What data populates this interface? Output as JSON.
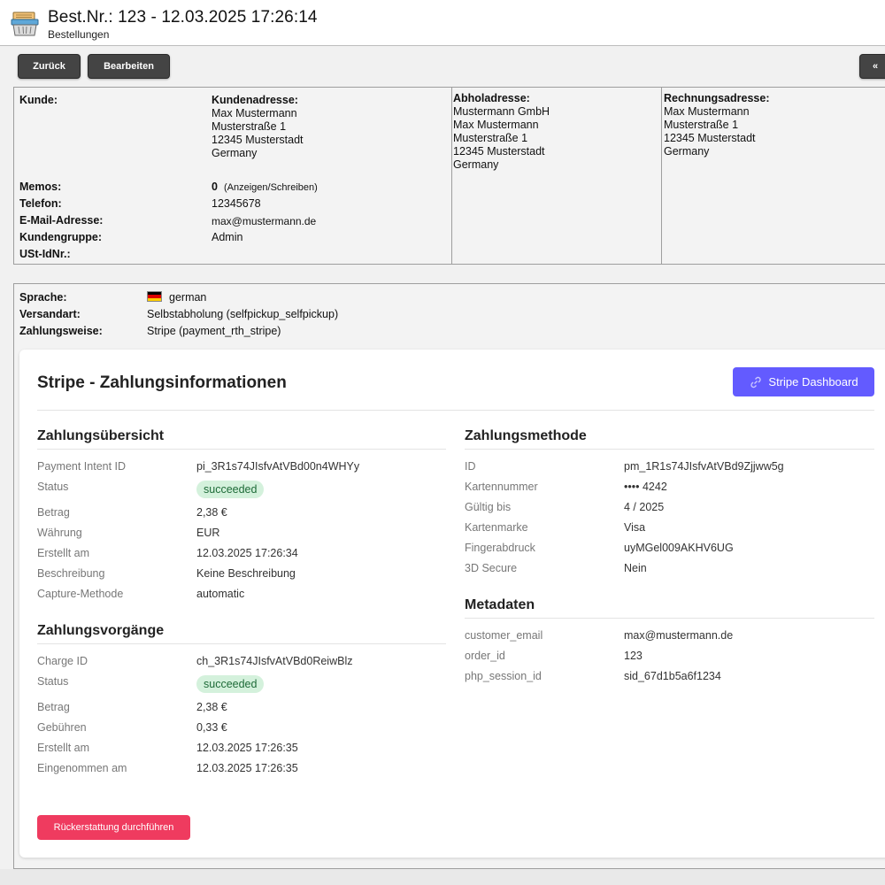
{
  "header": {
    "title": "Best.Nr.: 123 - 12.03.2025 17:26:14",
    "subtitle": "Bestellungen",
    "icon": "order-basket-icon"
  },
  "toolbar": {
    "back_label": "Zurück",
    "edit_label": "Bearbeiten",
    "collapse_label": "«"
  },
  "customer": {
    "kunde_label": "Kunde:",
    "address_label": "Kundenadresse:",
    "address_lines": [
      "Max Mustermann",
      "Musterstraße 1",
      "12345 Musterstadt",
      "Germany"
    ],
    "pickup_label": "Abholadresse:",
    "pickup_lines": [
      "Mustermann GmbH",
      "Max Mustermann",
      "Musterstraße 1",
      "12345 Musterstadt",
      "Germany"
    ],
    "billing_label": "Rechnungsadresse:",
    "billing_lines": [
      "Max Mustermann",
      "Musterstraße 1",
      "12345 Musterstadt",
      "Germany"
    ],
    "memos_label": "Memos:",
    "memos_count": "0",
    "memos_link": "(Anzeigen/Schreiben)",
    "phone_label": "Telefon:",
    "phone_value": "12345678",
    "email_label": "E-Mail-Adresse:",
    "email_value": "max@mustermann.de",
    "group_label": "Kundengruppe:",
    "group_value": "Admin",
    "vat_label": "USt-IdNr.:"
  },
  "order": {
    "language_label": "Sprache:",
    "language_value": "german",
    "shipping_label": "Versandart:",
    "shipping_value": "Selbstabholung (selfpickup_selfpickup)",
    "payment_label": "Zahlungsweise:",
    "payment_value": "Stripe (payment_rth_stripe)"
  },
  "stripe": {
    "title": "Stripe - Zahlungsinformationen",
    "dashboard_button": "Stripe Dashboard",
    "dashboard_icon": "link-icon",
    "accent_color": "#635bff",
    "overview": {
      "title": "Zahlungsübersicht",
      "rows": [
        {
          "key": "Payment Intent ID",
          "value": "pi_3R1s74JIsfvAtVBd00n4WHYy"
        },
        {
          "key": "Status",
          "value": "succeeded"
        },
        {
          "key": "Betrag",
          "value": "2,38 €"
        },
        {
          "key": "Währung",
          "value": "EUR"
        },
        {
          "key": "Erstellt am",
          "value": "12.03.2025 17:26:34"
        },
        {
          "key": "Beschreibung",
          "value": "Keine Beschreibung"
        },
        {
          "key": "Capture-Methode",
          "value": "automatic"
        }
      ]
    },
    "transactions": {
      "title": "Zahlungsvorgänge",
      "rows": [
        {
          "key": "Charge ID",
          "value": "ch_3R1s74JIsfvAtVBd0ReiwBlz"
        },
        {
          "key": "Status",
          "value": "succeeded"
        },
        {
          "key": "Betrag",
          "value": "2,38 €"
        },
        {
          "key": "Gebühren",
          "value": "0,33 €"
        },
        {
          "key": "Erstellt am",
          "value": "12.03.2025 17:26:35"
        },
        {
          "key": "Eingenommen am",
          "value": "12.03.2025 17:26:35"
        }
      ]
    },
    "method": {
      "title": "Zahlungsmethode",
      "rows": [
        {
          "key": "ID",
          "value": "pm_1R1s74JIsfvAtVBd9Zjjww5g"
        },
        {
          "key": "Kartennummer",
          "value": "•••• 4242"
        },
        {
          "key": "Gültig bis",
          "value": "4 / 2025"
        },
        {
          "key": "Kartenmarke",
          "value": "Visa"
        },
        {
          "key": "Fingerabdruck",
          "value": "uyMGel009AKHV6UG"
        },
        {
          "key": "3D Secure",
          "value": "Nein"
        }
      ]
    },
    "metadata": {
      "title": "Metadaten",
      "rows": [
        {
          "key": "customer_email",
          "value": "max@mustermann.de"
        },
        {
          "key": "order_id",
          "value": "123"
        },
        {
          "key": "php_session_id",
          "value": "sid_67d1b5a6f1234"
        }
      ]
    },
    "refund_button": "Rückerstattung durchführen",
    "refund_color": "#ef3b5f",
    "status_color": "#d4f1dc"
  }
}
